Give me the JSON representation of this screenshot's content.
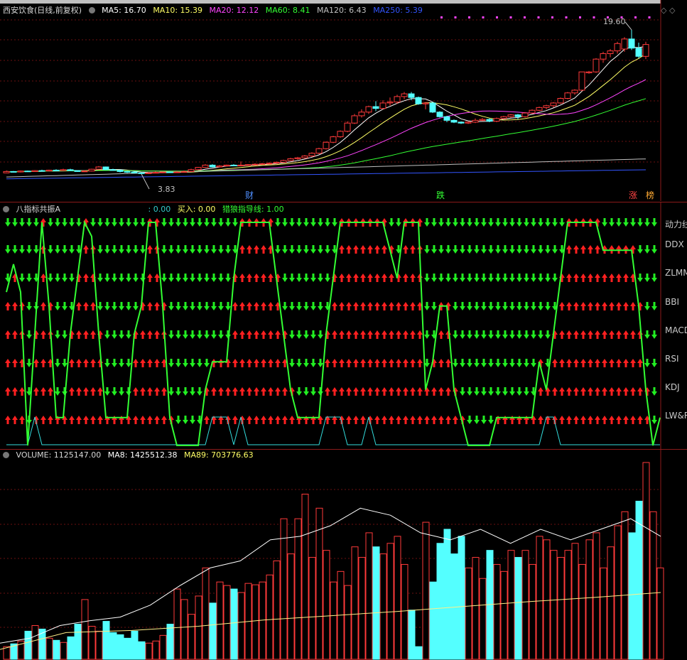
{
  "stock": {
    "name": "西安饮食(日线,前复权)"
  },
  "price_header": {
    "ma5": "MA5: 16.70",
    "ma10": "MA10: 15.39",
    "ma20": "MA20: 12.12",
    "ma60": "MA60: 8.41",
    "ma120": "MA120: 6.43",
    "ma250": "MA250: 5.39"
  },
  "price_labels": {
    "high": "19.60",
    "low": "3.83"
  },
  "event_tags": {
    "cai": "财",
    "die": "跌",
    "zhang": "涨",
    "bang": "榜"
  },
  "signal_header": {
    "title": "八指标共振A",
    "v1": ": 0.00",
    "buy": "买入: 0.00",
    "guide": "猎狼指导线: 1.00"
  },
  "signal_rows": [
    "动力线",
    "DDX",
    "ZLMM",
    "BBI",
    "MACD",
    "RSI",
    "KDJ",
    "LW&R"
  ],
  "volume_header": {
    "vol": "VOLUME: 1125147.00",
    "ma8": "MA8: 1425512.38",
    "ma89": "MA89: 703776.63"
  },
  "colors": {
    "up": "#ff3a3a",
    "down": "#54ffff",
    "ma5": "#ffffff",
    "ma10": "#ffff66",
    "ma20": "#ff44ff",
    "ma60": "#33ff33",
    "ma120": "#c0c0c0",
    "ma250": "#3355ff",
    "guide": "#33ff33",
    "trace": "#33dddd"
  },
  "chart_data": [
    {
      "type": "candlestick",
      "title": "西安饮食(日线,前复权)",
      "ylim": [
        2.5,
        21
      ],
      "candles": [
        [
          3.95,
          4.1,
          4.2,
          3.9
        ],
        [
          4.1,
          4.05,
          4.15,
          4.0
        ],
        [
          4.05,
          4.15,
          4.2,
          4.0
        ],
        [
          4.15,
          4.1,
          4.2,
          4.05
        ],
        [
          4.1,
          4.2,
          4.25,
          4.05
        ],
        [
          4.2,
          4.15,
          4.3,
          4.1
        ],
        [
          4.15,
          4.25,
          4.3,
          4.1
        ],
        [
          4.25,
          4.2,
          4.35,
          4.15
        ],
        [
          4.2,
          4.3,
          4.4,
          4.15
        ],
        [
          4.3,
          4.2,
          4.4,
          4.15
        ],
        [
          4.2,
          4.1,
          4.25,
          4.05
        ],
        [
          4.1,
          4.15,
          4.2,
          4.05
        ],
        [
          4.15,
          4.35,
          4.4,
          4.1
        ],
        [
          4.35,
          4.6,
          4.7,
          4.3
        ],
        [
          4.6,
          4.3,
          4.65,
          4.25
        ],
        [
          4.3,
          4.25,
          4.4,
          4.2
        ],
        [
          4.25,
          4.1,
          4.3,
          4.0
        ],
        [
          4.1,
          4.05,
          4.15,
          3.95
        ],
        [
          4.05,
          3.95,
          4.1,
          3.9
        ],
        [
          3.95,
          3.9,
          4.0,
          3.83
        ],
        [
          3.9,
          3.95,
          4.05,
          3.85
        ],
        [
          3.95,
          4.0,
          4.1,
          3.9
        ],
        [
          4.0,
          4.05,
          4.1,
          3.95
        ],
        [
          4.05,
          4.0,
          4.1,
          3.95
        ],
        [
          4.0,
          4.05,
          4.15,
          3.95
        ],
        [
          4.05,
          4.1,
          4.2,
          4.0
        ],
        [
          4.1,
          4.3,
          4.4,
          4.05
        ],
        [
          4.3,
          4.55,
          4.6,
          4.25
        ],
        [
          4.55,
          4.8,
          4.9,
          4.5
        ],
        [
          4.8,
          4.6,
          4.9,
          4.55
        ],
        [
          4.6,
          4.7,
          4.8,
          4.55
        ],
        [
          4.7,
          4.8,
          4.85,
          4.65
        ],
        [
          4.8,
          4.75,
          4.9,
          4.7
        ],
        [
          4.75,
          4.8,
          5.2,
          4.7
        ],
        [
          4.8,
          4.85,
          4.9,
          4.75
        ],
        [
          4.85,
          4.9,
          5.0,
          4.8
        ],
        [
          4.9,
          4.95,
          5.05,
          4.85
        ],
        [
          4.95,
          5.0,
          5.1,
          4.9
        ],
        [
          5.0,
          5.1,
          5.2,
          4.95
        ],
        [
          5.1,
          5.3,
          5.4,
          5.05
        ],
        [
          5.3,
          5.5,
          5.6,
          5.25
        ],
        [
          5.5,
          5.6,
          5.7,
          5.4
        ],
        [
          5.6,
          5.8,
          5.9,
          5.5
        ],
        [
          5.8,
          6.1,
          6.2,
          5.7
        ],
        [
          6.1,
          6.6,
          6.7,
          6.0
        ],
        [
          6.6,
          7.3,
          7.4,
          6.5
        ],
        [
          7.3,
          7.9,
          8.0,
          7.2
        ],
        [
          7.9,
          8.5,
          8.6,
          7.8
        ],
        [
          8.5,
          9.4,
          9.6,
          8.4
        ],
        [
          9.4,
          10.2,
          10.4,
          9.3
        ],
        [
          10.2,
          10.6,
          10.9,
          10.0
        ],
        [
          10.6,
          11.2,
          11.3,
          10.4
        ],
        [
          11.2,
          11.0,
          11.8,
          10.7
        ],
        [
          11.0,
          11.6,
          11.9,
          10.9
        ],
        [
          11.6,
          11.7,
          12.2,
          11.3
        ],
        [
          11.7,
          12.3,
          12.5,
          11.5
        ],
        [
          12.3,
          12.6,
          12.8,
          12.0
        ],
        [
          12.6,
          12.2,
          12.8,
          11.9
        ],
        [
          12.2,
          11.5,
          12.3,
          11.4
        ],
        [
          11.5,
          11.6,
          11.7,
          10.9
        ],
        [
          11.6,
          10.6,
          11.7,
          10.5
        ],
        [
          10.6,
          10.1,
          10.7,
          10.0
        ],
        [
          10.1,
          9.7,
          10.2,
          9.5
        ],
        [
          9.7,
          9.5,
          9.8,
          9.4
        ],
        [
          9.5,
          9.4,
          9.6,
          9.3
        ],
        [
          9.4,
          9.5,
          9.6,
          9.3
        ],
        [
          9.5,
          9.7,
          9.9,
          9.4
        ],
        [
          9.7,
          9.8,
          9.95,
          9.6
        ],
        [
          9.8,
          9.6,
          9.9,
          9.5
        ],
        [
          9.6,
          9.9,
          10.0,
          9.5
        ],
        [
          9.9,
          10.1,
          10.2,
          9.8
        ],
        [
          10.1,
          10.3,
          10.4,
          10.0
        ],
        [
          10.3,
          10.1,
          10.4,
          9.8
        ],
        [
          10.1,
          10.5,
          10.6,
          10.0
        ],
        [
          10.5,
          10.8,
          10.9,
          10.4
        ],
        [
          10.8,
          11.1,
          11.2,
          10.7
        ],
        [
          11.1,
          11.3,
          11.4,
          10.9
        ],
        [
          11.3,
          11.6,
          11.7,
          11.1
        ],
        [
          11.6,
          12.1,
          12.2,
          11.5
        ],
        [
          12.1,
          12.7,
          12.8,
          12.0
        ],
        [
          12.7,
          13.0,
          13.1,
          12.5
        ],
        [
          13.0,
          15.0,
          15.0,
          12.9
        ],
        [
          14.9,
          15.0,
          15.1,
          14.8
        ],
        [
          15.0,
          16.4,
          16.5,
          14.9
        ],
        [
          16.4,
          17.0,
          17.2,
          16.0
        ],
        [
          17.0,
          17.3,
          17.5,
          16.6
        ],
        [
          17.3,
          18.1,
          18.3,
          17.0
        ],
        [
          17.5,
          18.6,
          18.8,
          17.2
        ],
        [
          18.6,
          17.6,
          19.6,
          17.4
        ],
        [
          17.6,
          16.7,
          18.2,
          16.5
        ],
        [
          16.7,
          18.0,
          18.3,
          16.4
        ]
      ]
    },
    {
      "type": "indicator",
      "title": "八指标共振A",
      "rows": [
        "动力线",
        "DDX",
        "ZLMM",
        "BBI",
        "MACD",
        "RSI",
        "KDJ",
        "LW&R"
      ],
      "guide_line_levels": [
        5.5,
        6.5,
        5.5,
        0,
        4,
        8,
        5,
        1,
        1,
        4,
        6,
        8,
        7.5,
        4,
        1,
        1,
        1,
        1,
        4,
        5,
        8,
        8,
        5,
        1,
        0,
        0,
        0,
        0,
        2,
        3,
        3,
        3,
        6,
        8,
        8,
        8,
        8,
        8,
        6,
        4,
        2,
        1,
        1,
        1,
        1,
        4,
        6,
        8,
        8,
        8,
        8,
        8,
        8,
        8,
        7,
        6,
        8,
        8,
        8,
        2,
        3,
        5,
        5,
        2,
        1,
        0,
        0,
        0,
        0,
        1,
        1,
        1,
        1,
        1,
        1,
        3,
        2,
        4,
        6,
        8,
        8,
        8,
        8,
        8,
        7,
        7,
        7,
        7,
        7,
        5,
        2,
        0,
        1
      ],
      "trace_line_levels": [
        0,
        0,
        0,
        0,
        1,
        0,
        0,
        0,
        0,
        0,
        0,
        0,
        0,
        0,
        0,
        0,
        0,
        0,
        0,
        0,
        0,
        0,
        0,
        0,
        0,
        0,
        0,
        0,
        0,
        1,
        1,
        1,
        0,
        1,
        0,
        0,
        0,
        0,
        0,
        0,
        0,
        0,
        0,
        0,
        0,
        1,
        1,
        1,
        0,
        0,
        0,
        1,
        0,
        0,
        0,
        0,
        0,
        0,
        0,
        0,
        0,
        0,
        0,
        0,
        0,
        0,
        0,
        0,
        0,
        0,
        0,
        0,
        0,
        0,
        0,
        0,
        1,
        1,
        0,
        0,
        0,
        0,
        0,
        0,
        0,
        0,
        0,
        0,
        0,
        0,
        0,
        0,
        0
      ]
    },
    {
      "type": "bar",
      "title": "VOLUME",
      "ylim": [
        0,
        2800000
      ],
      "values": [
        180000,
        220000,
        260000,
        400000,
        480000,
        430000,
        300000,
        270000,
        240000,
        320000,
        500000,
        850000,
        470000,
        400000,
        540000,
        380000,
        350000,
        300000,
        400000,
        250000,
        230000,
        260000,
        340000,
        500000,
        1000000,
        850000,
        640000,
        900000,
        1300000,
        800000,
        1100000,
        1050000,
        1000000,
        950000,
        1080000,
        1060000,
        1100000,
        1200000,
        1400000,
        2000000,
        1500000,
        2000000,
        2350000,
        1450000,
        2150000,
        1550000,
        1100000,
        1250000,
        1050000,
        1600000,
        1450000,
        1800000,
        1600000,
        1500000,
        1650000,
        1750000,
        1350000,
        700000,
        180000,
        1950000,
        1100000,
        1650000,
        1850000,
        1500000,
        1750000,
        1300000,
        1450000,
        1150000,
        1550000,
        1350000,
        1250000,
        1550000,
        1450000,
        1550000,
        1350000,
        1750000,
        1700000,
        1550000,
        1450000,
        1550000,
        1650000,
        1350000,
        1700000,
        1800000,
        1300000,
        1600000,
        1900000,
        2100000,
        1800000,
        2250000,
        2800000,
        2100000,
        1300000
      ],
      "ma8_trend_levels": [
        230000,
        300000,
        480000,
        550000,
        600000,
        770000,
        1050000,
        1300000,
        1400000,
        1700000,
        1750000,
        1900000,
        2150000,
        2050000,
        1800000,
        1700000,
        1850000,
        1650000,
        1850000,
        1700000,
        1850000,
        2000000,
        1750000
      ],
      "ma89_trend_levels": [
        140000,
        380000,
        410000,
        470000,
        560000,
        620000,
        680000,
        750000,
        820000,
        880000,
        950000
      ]
    }
  ]
}
